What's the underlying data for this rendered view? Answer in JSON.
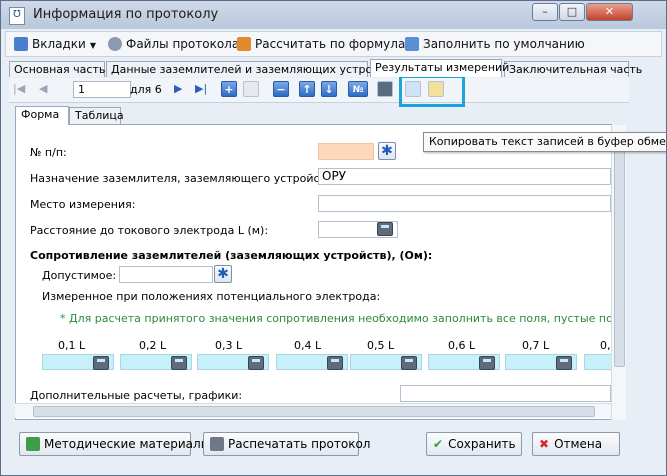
{
  "window": {
    "title": "Информация по протоколу",
    "app_icon": "Ʊ",
    "controls": {
      "minimize": "–",
      "maximize": "□",
      "close": "✕"
    }
  },
  "menubar": {
    "tabs_menu": "Вкладки",
    "files": "Файлы протокола",
    "calculate": "Рассчитать по формулам",
    "fill_default": "Заполнить по умолчанию"
  },
  "tabs": [
    {
      "label": "Основная часть"
    },
    {
      "label": "Данные заземлителей и заземляющих устройств"
    },
    {
      "label": "Результаты измерений"
    },
    {
      "label": "Заключительная часть"
    }
  ],
  "navigator": {
    "first": "|◀",
    "prev": "◀",
    "record": "1",
    "of_text": "для 6",
    "next": "▶",
    "last": "▶|",
    "btn_n": "№"
  },
  "subtabs": [
    {
      "label": "Форма"
    },
    {
      "label": "Таблица"
    }
  ],
  "tooltip": "Копировать текст записей в буфер обмена",
  "form": {
    "num_label": "№ п/п:",
    "purpose_label": "Назначение заземлителя, заземляющего устройства:",
    "purpose_value": "ОРУ",
    "place_label": "Место измерения:",
    "distance_label": "Расстояние до токового электрода L (м):",
    "resistance_heading": "Сопротивление заземлителей (заземляющих устройств), (Ом):",
    "allowed_label": "Допустимое:",
    "measured_label": "Измеренное при положениях потенциального электрода:",
    "note": "* Для расчета принятого значения сопротивления необходимо заполнить все поля, пустые поля необходим",
    "positions": [
      "0,1 L",
      "0,2 L",
      "0,3 L",
      "0,4 L",
      "0,5 L",
      "0,6 L",
      "0,7 L",
      "0,"
    ],
    "extra_label": "Дополнительные расчеты, графики:"
  },
  "buttons": {
    "methodical": "Методические материалы",
    "print": "Распечатать протокол",
    "save": "Сохранить",
    "cancel": "Отмена"
  },
  "colors": {
    "highlight": "#1da3e0",
    "required_field": "#fdd8bd",
    "formula_field": "#c6f1fb",
    "note_green": "#2c8a3a"
  }
}
